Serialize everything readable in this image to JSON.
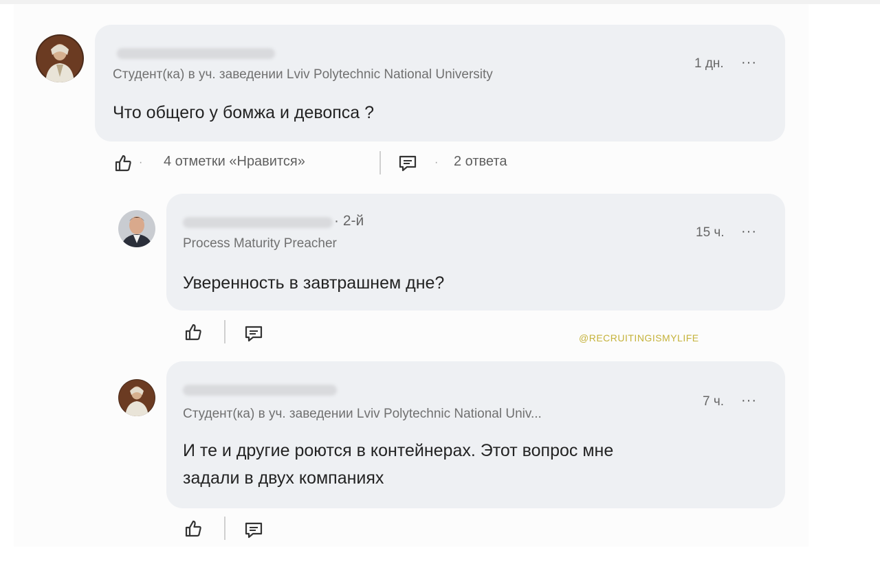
{
  "comment": {
    "subtitle": "Студент(ка) в уч. заведении Lviv Polytechnic National University",
    "time": "1 дн.",
    "more": "···",
    "text": "Что общего у бомжа и девопса ?",
    "likes_label": "4 отметки «Нравится»",
    "replies_label": "2 ответа",
    "separator": "·"
  },
  "reply1": {
    "degree": "· 2-й",
    "subtitle": "Process Maturity Preacher",
    "time": "15 ч.",
    "more": "···",
    "text": "Уверенность в завтрашнем дне?"
  },
  "watermark": "@RECRUITINGISMYLIFE",
  "reply2": {
    "subtitle": "Студент(ка) в уч. заведении Lviv Polytechnic National Univ...",
    "time": "7 ч.",
    "more": "···",
    "text_line1": "И те и другие роются в контейнерах.  Этот вопрос мне",
    "text_line2": "задали в двух компаниях"
  },
  "icons": {
    "like": "thumbs-up-icon",
    "reply": "comment-icon"
  },
  "colors": {
    "bubble": "#eef0f3",
    "text": "#232323",
    "muted": "#707070",
    "watermark": "#c5b23a"
  }
}
